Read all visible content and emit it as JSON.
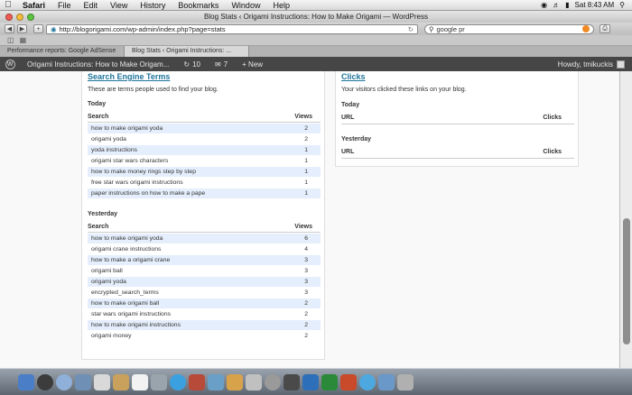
{
  "menubar": {
    "app": "Safari",
    "items": [
      "File",
      "Edit",
      "View",
      "History",
      "Bookmarks",
      "Window",
      "Help"
    ],
    "status": "Sat 8:43 AM"
  },
  "window": {
    "title": "Blog Stats ‹ Origami Instructions: How to Make Origami — WordPress"
  },
  "toolbar": {
    "url": "http://blogorigami.com/wp-admin/index.php?page=stats",
    "search_value": "google pr"
  },
  "tabs": [
    {
      "label": "Performance reports: Google AdSense"
    },
    {
      "label": "Blog Stats ‹ Origami Instructions: ..."
    }
  ],
  "adminbar": {
    "site": "Origami Instructions: How to Make Origam...",
    "updates": "10",
    "comments": "7",
    "new": "+ New",
    "howdy": "Howdy, tmikuckis"
  },
  "search_terms": {
    "title": "Search Engine Terms",
    "description": "These are terms people used to find your blog.",
    "today_label": "Today",
    "yesterday_label": "Yesterday",
    "col_search": "Search",
    "col_views": "Views",
    "today": [
      {
        "term": "how to make origami yoda",
        "views": "2"
      },
      {
        "term": "origami yoda",
        "views": "2"
      },
      {
        "term": "yoda instructions",
        "views": "1"
      },
      {
        "term": "origami star wars characters",
        "views": "1"
      },
      {
        "term": "how to make money rings step by step",
        "views": "1"
      },
      {
        "term": "free star wars origami instructions",
        "views": "1"
      },
      {
        "term": "paper instructions on how to make a pape",
        "views": "1"
      }
    ],
    "yesterday": [
      {
        "term": "how to make origami yoda",
        "views": "6"
      },
      {
        "term": "origami crane instructions",
        "views": "4"
      },
      {
        "term": "how to make a origami crane",
        "views": "3"
      },
      {
        "term": "origami ball",
        "views": "3"
      },
      {
        "term": "origami yoda",
        "views": "3"
      },
      {
        "term": "encrypted_search_terms",
        "views": "3"
      },
      {
        "term": "how to make origami ball",
        "views": "2"
      },
      {
        "term": "star wars origami instructions",
        "views": "2"
      },
      {
        "term": "how to make origami instructions",
        "views": "2"
      },
      {
        "term": "origami money",
        "views": "2"
      }
    ]
  },
  "clicks": {
    "title": "Clicks",
    "description": "Your visitors clicked these links on your blog.",
    "today_label": "Today",
    "yesterday_label": "Yesterday",
    "col_url": "URL",
    "col_clicks": "Clicks"
  },
  "colors": {
    "link": "#21759b",
    "row_alt": "#e5eefc",
    "adminbar": "#464646"
  }
}
